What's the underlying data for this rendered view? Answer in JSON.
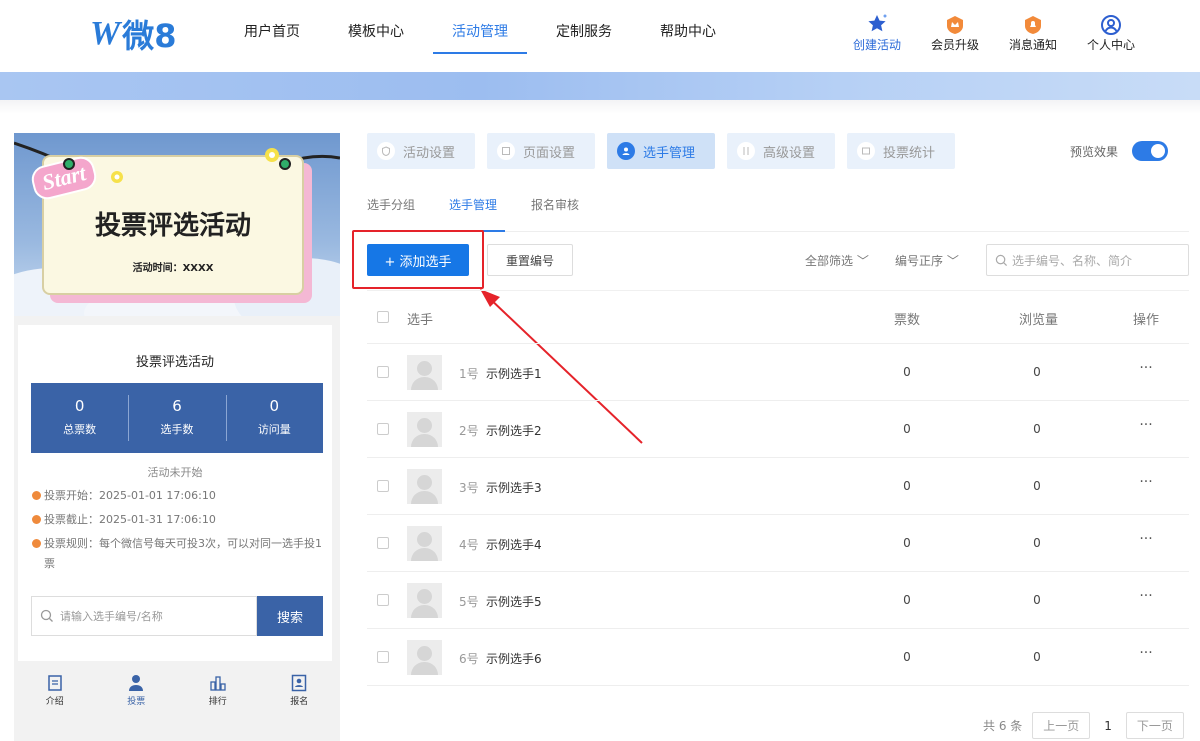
{
  "header": {
    "logo_letter": "W",
    "logo_text": "微8",
    "nav": [
      "用户首页",
      "模板中心",
      "活动管理",
      "定制服务",
      "帮助中心"
    ],
    "nav_active": "活动管理",
    "tools": [
      {
        "label": "创建活动",
        "icon": "star-icon"
      },
      {
        "label": "会员升级",
        "icon": "crown-badge-icon"
      },
      {
        "label": "消息通知",
        "icon": "bell-badge-icon"
      },
      {
        "label": "个人中心",
        "icon": "user-circle-icon"
      }
    ]
  },
  "preview": {
    "poster": {
      "start_label": "Start",
      "title": "投票评选活动",
      "time": "活动时间：XXXX"
    },
    "info_title": "投票评选活动",
    "stats": [
      {
        "value": "0",
        "label": "总票数"
      },
      {
        "value": "6",
        "label": "选手数"
      },
      {
        "value": "0",
        "label": "访问量"
      }
    ],
    "status": "活动未开始",
    "rules": [
      "投票开始：2025-01-01 17:06:10",
      "投票截止：2025-01-31 17:06:10",
      "投票规则：每个微信号每天可投3次，可以对同一选手投1票"
    ],
    "search_placeholder": "请输入选手编号/名称",
    "search_button": "搜索",
    "tabbar": [
      {
        "label": "介绍",
        "icon": "doc-icon"
      },
      {
        "label": "投票",
        "icon": "person-icon"
      },
      {
        "label": "排行",
        "icon": "bar-chart-icon"
      },
      {
        "label": "报名",
        "icon": "id-card-icon"
      }
    ]
  },
  "main": {
    "page_tabs": [
      "活动设置",
      "页面设置",
      "选手管理",
      "高级设置",
      "投票统计"
    ],
    "page_tab_active": "选手管理",
    "preview_label": "预览效果",
    "preview_on": true,
    "sub_tabs": [
      "选手分组",
      "选手管理",
      "报名审核"
    ],
    "sub_tab_active": "选手管理",
    "add_button": "+ 添加选手",
    "renumber_button": "重置编号",
    "filter_all": "全部筛选",
    "sort_label": "编号正序",
    "search_placeholder": "选手编号、名称、简介",
    "columns": [
      "选手",
      "票数",
      "浏览量",
      "操作"
    ],
    "rows": [
      {
        "no": "1号",
        "name": "示例选手1",
        "votes": "0",
        "views": "0",
        "op": "···"
      },
      {
        "no": "2号",
        "name": "示例选手2",
        "votes": "0",
        "views": "0",
        "op": "···"
      },
      {
        "no": "3号",
        "name": "示例选手3",
        "votes": "0",
        "views": "0",
        "op": "···"
      },
      {
        "no": "4号",
        "name": "示例选手4",
        "votes": "0",
        "views": "0",
        "op": "···"
      },
      {
        "no": "5号",
        "name": "示例选手5",
        "votes": "0",
        "views": "0",
        "op": "···"
      },
      {
        "no": "6号",
        "name": "示例选手6",
        "votes": "0",
        "views": "0",
        "op": "···"
      }
    ],
    "pager": {
      "total": "共 6 条",
      "prev": "上一页",
      "page": "1",
      "next": "下一页"
    }
  },
  "colors": {
    "accent": "#2d7be6",
    "preview_blue": "#3a63a7",
    "annotation_red": "#e5232a"
  }
}
